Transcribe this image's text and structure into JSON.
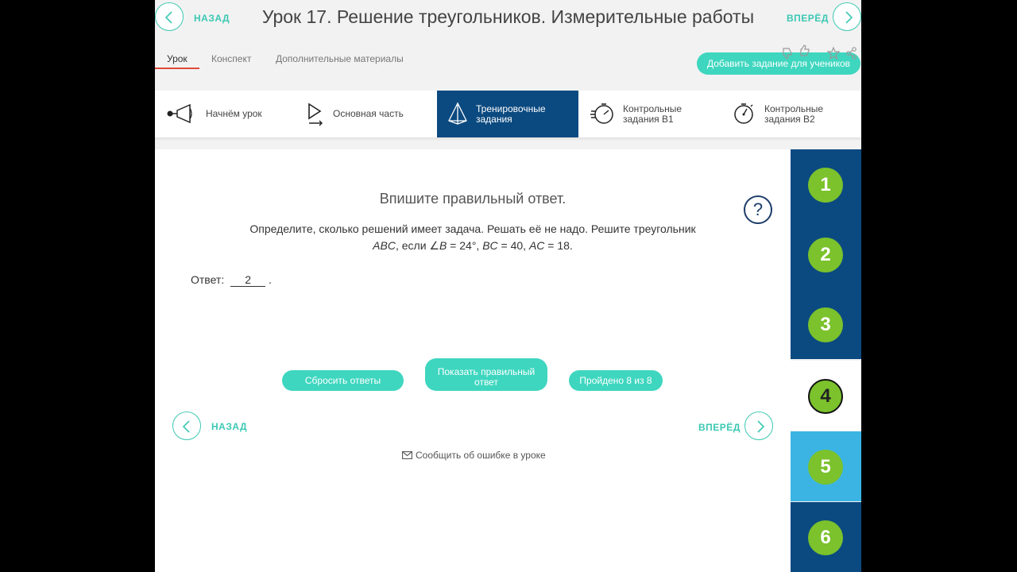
{
  "header": {
    "back_label": "НАЗАД",
    "next_label": "ВПЕРЁД",
    "title": "Урок 17. Решение треугольников. Измерительные работы"
  },
  "tabs": [
    {
      "label": "Урок",
      "active": true
    },
    {
      "label": "Конспект",
      "active": false
    },
    {
      "label": "Дополнительные материалы",
      "active": false
    }
  ],
  "toolbar": {
    "add_task_label": "Добавить задание для учеников",
    "icons": [
      "thumbs-down-icon",
      "thumbs-up-icon",
      "star-icon",
      "share-icon"
    ]
  },
  "sections": [
    {
      "label_line1": "Начнём урок",
      "label_line2": "",
      "icon": "megaphone-icon"
    },
    {
      "label_line1": "Основная часть",
      "label_line2": "",
      "icon": "play-icon"
    },
    {
      "label_line1": "Тренировочные",
      "label_line2": "задания",
      "icon": "pyramid-icon",
      "active": true
    },
    {
      "label_line1": "Контрольные",
      "label_line2": "задания В1",
      "icon": "timer-icon"
    },
    {
      "label_line1": "Контрольные",
      "label_line2": "задания В2",
      "icon": "stopwatch-icon"
    }
  ],
  "task": {
    "instruction": "Впишите правильный ответ.",
    "question_line1": "Определите, сколько решений имеет задача. Решать её не надо. Решите треугольник",
    "q_abc": "ABC",
    "q_if": ", если ∠",
    "q_b": "B",
    "q_b_val": " = 24°, ",
    "q_bc": "BC",
    "q_bc_val": " = 40, ",
    "q_ac": "AC",
    "q_ac_val": " = 18.",
    "answer_label": "Ответ:",
    "answer_value": "2",
    "answer_suffix": "."
  },
  "buttons": {
    "reset": "Сбросить ответы",
    "show_line1": "Показать правильный",
    "show_line2": "ответ",
    "progress": "Пройдено 8 из 8"
  },
  "footer": {
    "back_label": "НАЗАД",
    "next_label": "ВПЕРЁД",
    "report_label": "Сообщить об ошибке в уроке"
  },
  "task_numbers": [
    "1",
    "2",
    "3",
    "4",
    "5",
    "6"
  ],
  "current_task": "4",
  "colors": {
    "accent": "#3ed6bf",
    "nav_dark": "#0b4a80",
    "task_done": "#7bc22c",
    "task_highlight": "#3bb4e4",
    "tab_underline": "#e04a3a"
  }
}
